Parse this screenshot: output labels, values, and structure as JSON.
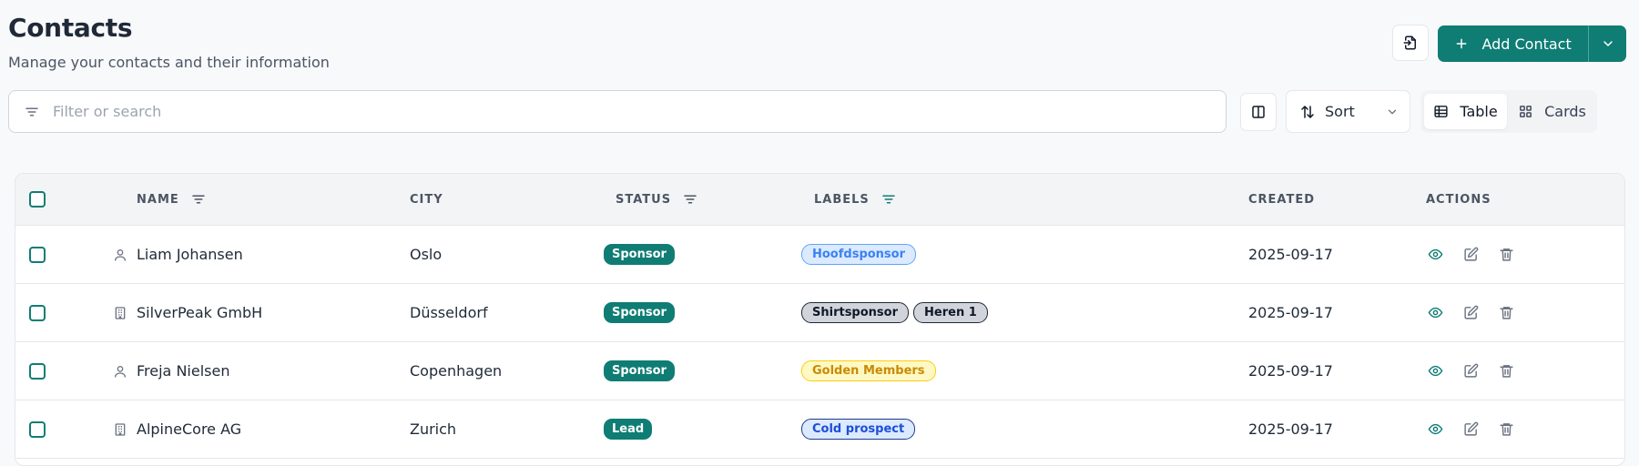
{
  "header": {
    "title": "Contacts",
    "subtitle": "Manage your contacts and their information",
    "export_icon": "file-export-icon",
    "add_button_label": "Add Contact"
  },
  "toolbar": {
    "search_placeholder": "Filter or search",
    "sort_label": "Sort",
    "view_options": [
      {
        "label": "Table",
        "icon": "table-icon",
        "active": true
      },
      {
        "label": "Cards",
        "icon": "grid-icon",
        "active": false
      }
    ]
  },
  "table": {
    "columns": {
      "name": "NAME",
      "city": "CITY",
      "status": "STATUS",
      "labels": "LABELS",
      "created": "CREATED",
      "actions": "ACTIONS"
    },
    "rows": [
      {
        "type": "person",
        "name": "Liam Johansen",
        "city": "Oslo",
        "status": "Sponsor",
        "labels": [
          {
            "text": "Hoofdsponsor",
            "bg": "#dbeafe",
            "border": "#60a5fa",
            "color": "#3b82f6"
          }
        ],
        "created": "2025-09-17"
      },
      {
        "type": "company",
        "name": "SilverPeak GmbH",
        "city": "Düsseldorf",
        "status": "Sponsor",
        "labels": [
          {
            "text": "Shirtsponsor",
            "bg": "#d1d5db",
            "border": "#1f2937",
            "color": "#111827"
          },
          {
            "text": "Heren 1",
            "bg": "#d1d5db",
            "border": "#1f2937",
            "color": "#111827"
          }
        ],
        "created": "2025-09-17"
      },
      {
        "type": "person",
        "name": "Freja Nielsen",
        "city": "Copenhagen",
        "status": "Sponsor",
        "labels": [
          {
            "text": "Golden Members",
            "bg": "#fef9c3",
            "border": "#facc15",
            "color": "#ca8a04"
          }
        ],
        "created": "2025-09-17"
      },
      {
        "type": "company",
        "name": "AlpineCore AG",
        "city": "Zurich",
        "status": "Lead",
        "labels": [
          {
            "text": "Cold prospect",
            "bg": "#dbeafe",
            "border": "#1e3a8a",
            "color": "#1d4ed8"
          }
        ],
        "created": "2025-09-17"
      }
    ]
  },
  "colors": {
    "accent": "#0f7d74",
    "background": "#f8f9fb"
  }
}
